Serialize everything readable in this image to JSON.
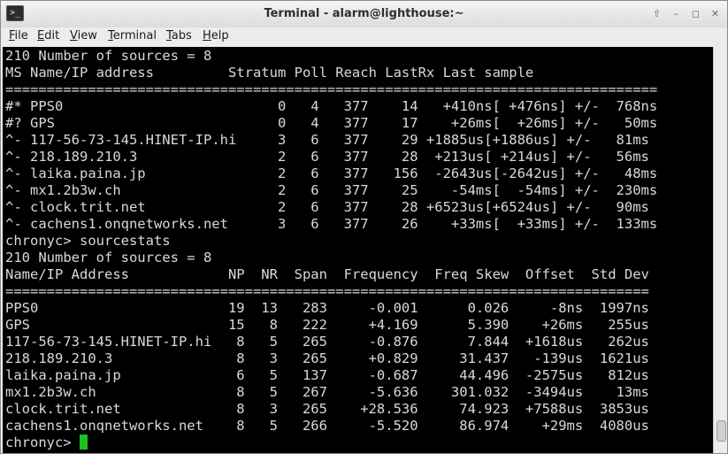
{
  "window": {
    "title": "Terminal - alarm@lighthouse:~",
    "icon": "terminal-icon"
  },
  "window_controls": [
    {
      "name": "up-arrow-icon",
      "glyph": "⇧"
    },
    {
      "name": "minimize-icon",
      "glyph": "–"
    },
    {
      "name": "maximize-icon",
      "glyph": "◻"
    },
    {
      "name": "close-icon",
      "glyph": "✕"
    }
  ],
  "menu": {
    "file": {
      "u": "F",
      "rest": "ile"
    },
    "edit": {
      "u": "E",
      "rest": "dit"
    },
    "view": {
      "u": "V",
      "rest": "iew"
    },
    "terminal": {
      "u": "T",
      "rest": "erminal"
    },
    "tabs": {
      "u": "T",
      "rest": "abs"
    },
    "help": {
      "u": "H",
      "rest": "elp"
    }
  },
  "terminal": {
    "lines": [
      "210 Number of sources = 8",
      "MS Name/IP address         Stratum Poll Reach LastRx Last sample",
      "===============================================================================",
      "#* PPS0                          0   4   377    14   +410ns[ +476ns] +/-  768ns",
      "#? GPS                           0   4   377    17    +26ms[  +26ms] +/-   50ms",
      "^- 117-56-73-145.HINET-IP.hi     3   6   377    29 +1885us[+1886us] +/-   81ms",
      "^- 218.189.210.3                 2   6   377    28  +213us[ +214us] +/-   56ms",
      "^- laika.paina.jp                2   6   377   156  -2643us[-2642us] +/-   48ms",
      "^- mx1.2b3w.ch                   2   6   377    25    -54ms[  -54ms] +/-  230ms",
      "^- clock.trit.net                2   6   377    28 +6523us[+6524us] +/-   90ms",
      "^- cachens1.onqnetworks.net      3   6   377    26    +33ms[  +33ms] +/-  133ms",
      "chronyc> sourcestats",
      "210 Number of sources = 8",
      "Name/IP Address            NP  NR  Span  Frequency  Freq Skew  Offset  Std Dev",
      "==============================================================================",
      "PPS0                       19  13   283     -0.001      0.026     -8ns  1997ns",
      "GPS                        15   8   222     +4.169      5.390    +26ms   255us",
      "117-56-73-145.HINET-IP.hi   8   5   265     -0.876      7.844  +1618us   262us",
      "218.189.210.3               8   3   265     +0.829     31.437   -139us  1621us",
      "laika.paina.jp              6   5   137     -0.687     44.496  -2575us   812us",
      "mx1.2b3w.ch                 8   5   267     -5.636    301.032  -3494us    13ms",
      "clock.trit.net              8   3   265    +28.536     74.923  +7588us  3853us",
      "cachens1.onqnetworks.net    8   5   266     -5.520     86.974    +29ms  4080us"
    ],
    "prompt": "chronyc> "
  }
}
